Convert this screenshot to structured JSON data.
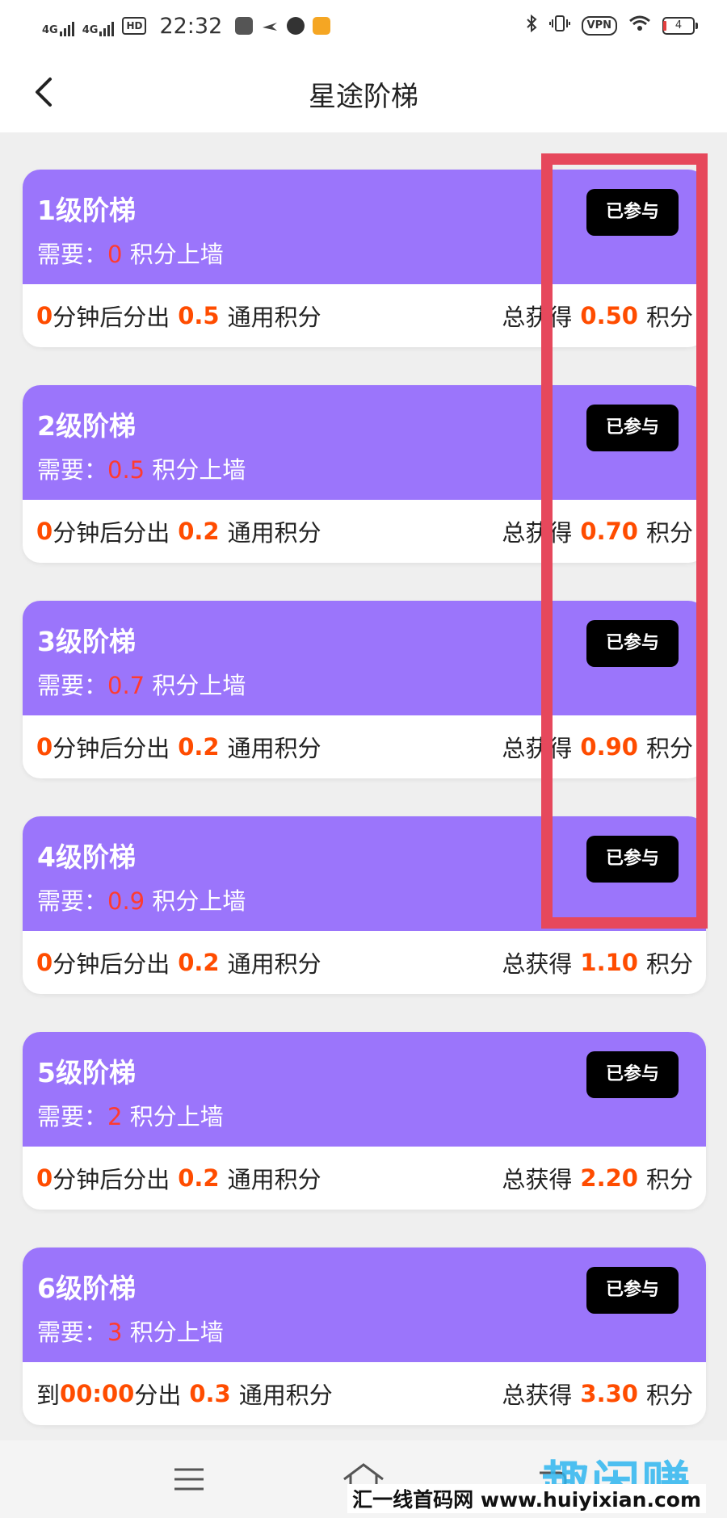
{
  "status_bar": {
    "time": "22:32",
    "network1": "4G",
    "network2": "4G",
    "hd": "HD",
    "vpn": "VPN",
    "battery": "4"
  },
  "header": {
    "title": "星途阶梯"
  },
  "cards": [
    {
      "level": "1级阶梯",
      "need_prefix": "需要：",
      "need_value": "0",
      "need_suffix": "积分上墙",
      "status": "已参与",
      "time_value": "0",
      "time_label": "分钟后分出",
      "amount": "0.5",
      "amount_label": "通用积分",
      "total_label": "总获得",
      "total_value": "0.50",
      "total_unit": "积分"
    },
    {
      "level": "2级阶梯",
      "need_prefix": "需要：",
      "need_value": "0.5",
      "need_suffix": "积分上墙",
      "status": "已参与",
      "time_value": "0",
      "time_label": "分钟后分出",
      "amount": "0.2",
      "amount_label": "通用积分",
      "total_label": "总获得",
      "total_value": "0.70",
      "total_unit": "积分"
    },
    {
      "level": "3级阶梯",
      "need_prefix": "需要：",
      "need_value": "0.7",
      "need_suffix": "积分上墙",
      "status": "已参与",
      "time_value": "0",
      "time_label": "分钟后分出",
      "amount": "0.2",
      "amount_label": "通用积分",
      "total_label": "总获得",
      "total_value": "0.90",
      "total_unit": "积分"
    },
    {
      "level": "4级阶梯",
      "need_prefix": "需要：",
      "need_value": "0.9",
      "need_suffix": "积分上墙",
      "status": "已参与",
      "time_value": "0",
      "time_label": "分钟后分出",
      "amount": "0.2",
      "amount_label": "通用积分",
      "total_label": "总获得",
      "total_value": "1.10",
      "total_unit": "积分"
    },
    {
      "level": "5级阶梯",
      "need_prefix": "需要：",
      "need_value": "2",
      "need_suffix": "积分上墙",
      "status": "已参与",
      "time_value": "0",
      "time_label": "分钟后分出",
      "amount": "0.2",
      "amount_label": "通用积分",
      "total_label": "总获得",
      "total_value": "2.20",
      "total_unit": "积分"
    },
    {
      "level": "6级阶梯",
      "need_prefix": "需要：",
      "need_value": "3",
      "need_suffix": "积分上墙",
      "status": "已参与",
      "time_prefix": "到",
      "time_value": "00:00",
      "time_label": "分出",
      "amount": "0.3",
      "amount_label": "通用积分",
      "total_label": "总获得",
      "total_value": "3.30",
      "total_unit": "积分"
    }
  ],
  "watermark": {
    "logo": "趣闲赚",
    "site": "汇一线首码网 www.huiyixian.com"
  },
  "colors": {
    "card_header": "#9b75fb",
    "highlight": "#e6485c",
    "accent_orange": "#ff4c00",
    "accent_red": "#ff3b30"
  }
}
